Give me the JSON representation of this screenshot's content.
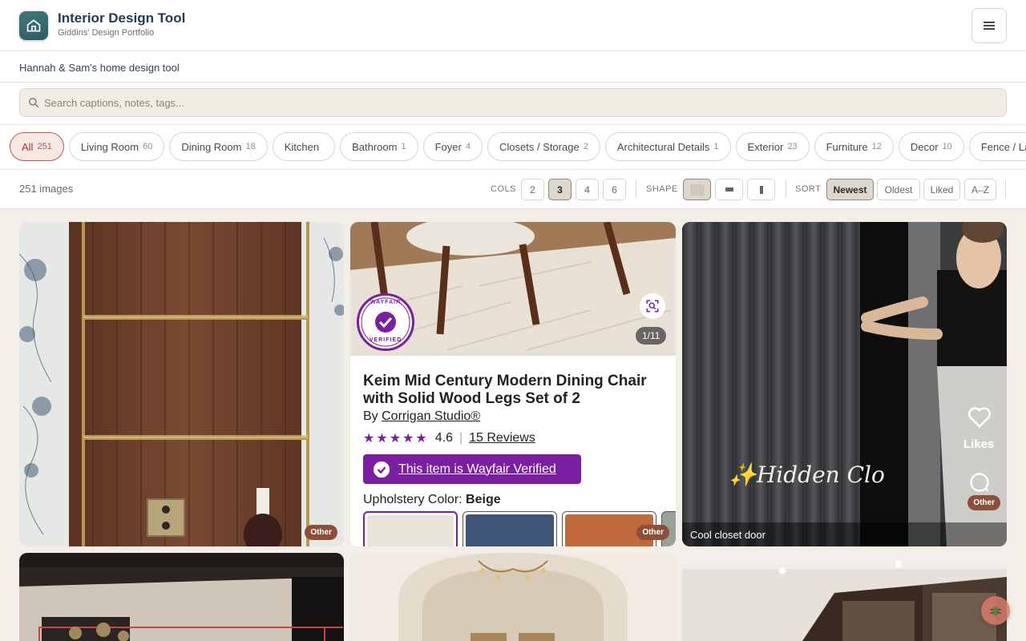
{
  "app": {
    "title": "Interior Design Tool",
    "subtitle": "Giddins' Design Portfolio",
    "tagline": "Hannah & Sam's home design tool"
  },
  "search": {
    "placeholder": "Search captions, notes, tags..."
  },
  "categories": [
    {
      "label": "All",
      "count": "251"
    },
    {
      "label": "Living Room",
      "count": "60"
    },
    {
      "label": "Dining Room",
      "count": "18"
    },
    {
      "label": "Kitchen",
      "count": ""
    },
    {
      "label": "Bathroom",
      "count": "1"
    },
    {
      "label": "Foyer",
      "count": "4"
    },
    {
      "label": "Closets / Storage",
      "count": "2"
    },
    {
      "label": "Architectural Details",
      "count": "1"
    },
    {
      "label": "Exterior",
      "count": "23"
    },
    {
      "label": "Furniture",
      "count": "12"
    },
    {
      "label": "Decor",
      "count": "10"
    },
    {
      "label": "Fence / La",
      "count": ""
    }
  ],
  "toolbar": {
    "image_count": "251 images",
    "cols_label": "COLS",
    "cols": [
      "2",
      "3",
      "4",
      "6"
    ],
    "cols_selected": "3",
    "shape_label": "SHAPE",
    "sort_label": "SORT",
    "sorts": [
      "Newest",
      "Oldest",
      "Liked",
      "A–Z"
    ],
    "sort_selected": "Newest"
  },
  "product": {
    "badge_top": "WAYFAIR",
    "badge_bottom": "VERIFIED",
    "counter": "1/11",
    "title": "Keim Mid Century Modern Dining Chair with Solid Wood Legs Set of 2",
    "by_prefix": "By ",
    "brand": "Corrigan Studio®",
    "rating": "4.6",
    "reviews": "15 Reviews",
    "verified_text": "This item is Wayfair Verified",
    "option_label": "Upholstery Color: ",
    "option_value": "Beige"
  },
  "closet": {
    "overlay": "✨Hidden Clo",
    "likes_label": "Likes",
    "caption": "Cool closet door"
  },
  "tiles": {
    "tag1": "Other",
    "tag2": "Other",
    "tag3": "Other"
  },
  "colors": {
    "accent": "#b35c50",
    "wayfair_purple": "#7b1fa2",
    "tag_brown": "#8b4f3a"
  }
}
